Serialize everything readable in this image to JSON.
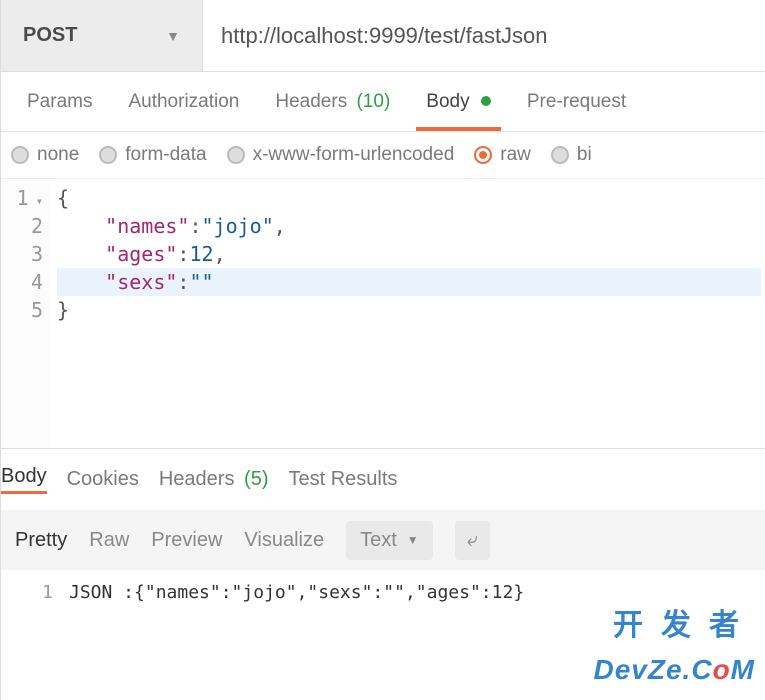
{
  "request": {
    "method": "POST",
    "url": "http://localhost:9999/test/fastJson"
  },
  "request_tabs": {
    "params": "Params",
    "authorization": "Authorization",
    "headers": "Headers",
    "headers_count": "(10)",
    "body": "Body",
    "prerequest": "Pre-request"
  },
  "body_types": {
    "none": "none",
    "form_data": "form-data",
    "x_www": "x-www-form-urlencoded",
    "raw": "raw",
    "binary": "bi"
  },
  "editor": {
    "lines": {
      "l1": "1",
      "l2": "2",
      "l3": "3",
      "l4": "4",
      "l5": "5"
    },
    "code": {
      "open_brace": "{",
      "k_names": "\"names\"",
      "v_names": "\"jojo\"",
      "k_ages": "\"ages\"",
      "v_ages": "12",
      "k_sexs": "\"sexs\"",
      "v_sexs": "\"\"",
      "close_brace": "}",
      "colon": ":",
      "comma": ","
    }
  },
  "response_tabs": {
    "body": "Body",
    "cookies": "Cookies",
    "headers": "Headers",
    "headers_count": "(5)",
    "test_results": "Test Results"
  },
  "response_toolbar": {
    "pretty": "Pretty",
    "raw": "Raw",
    "preview": "Preview",
    "visualize": "Visualize",
    "text": "Text"
  },
  "response_body": {
    "line_no": "1",
    "text": "JSON :{\"names\":\"jojo\",\"sexs\":\"\",\"ages\":12}"
  },
  "watermark": {
    "cn": "开发者",
    "en_prefix": "DevZe.C",
    "en_o": "o",
    "en_suffix": "M"
  }
}
